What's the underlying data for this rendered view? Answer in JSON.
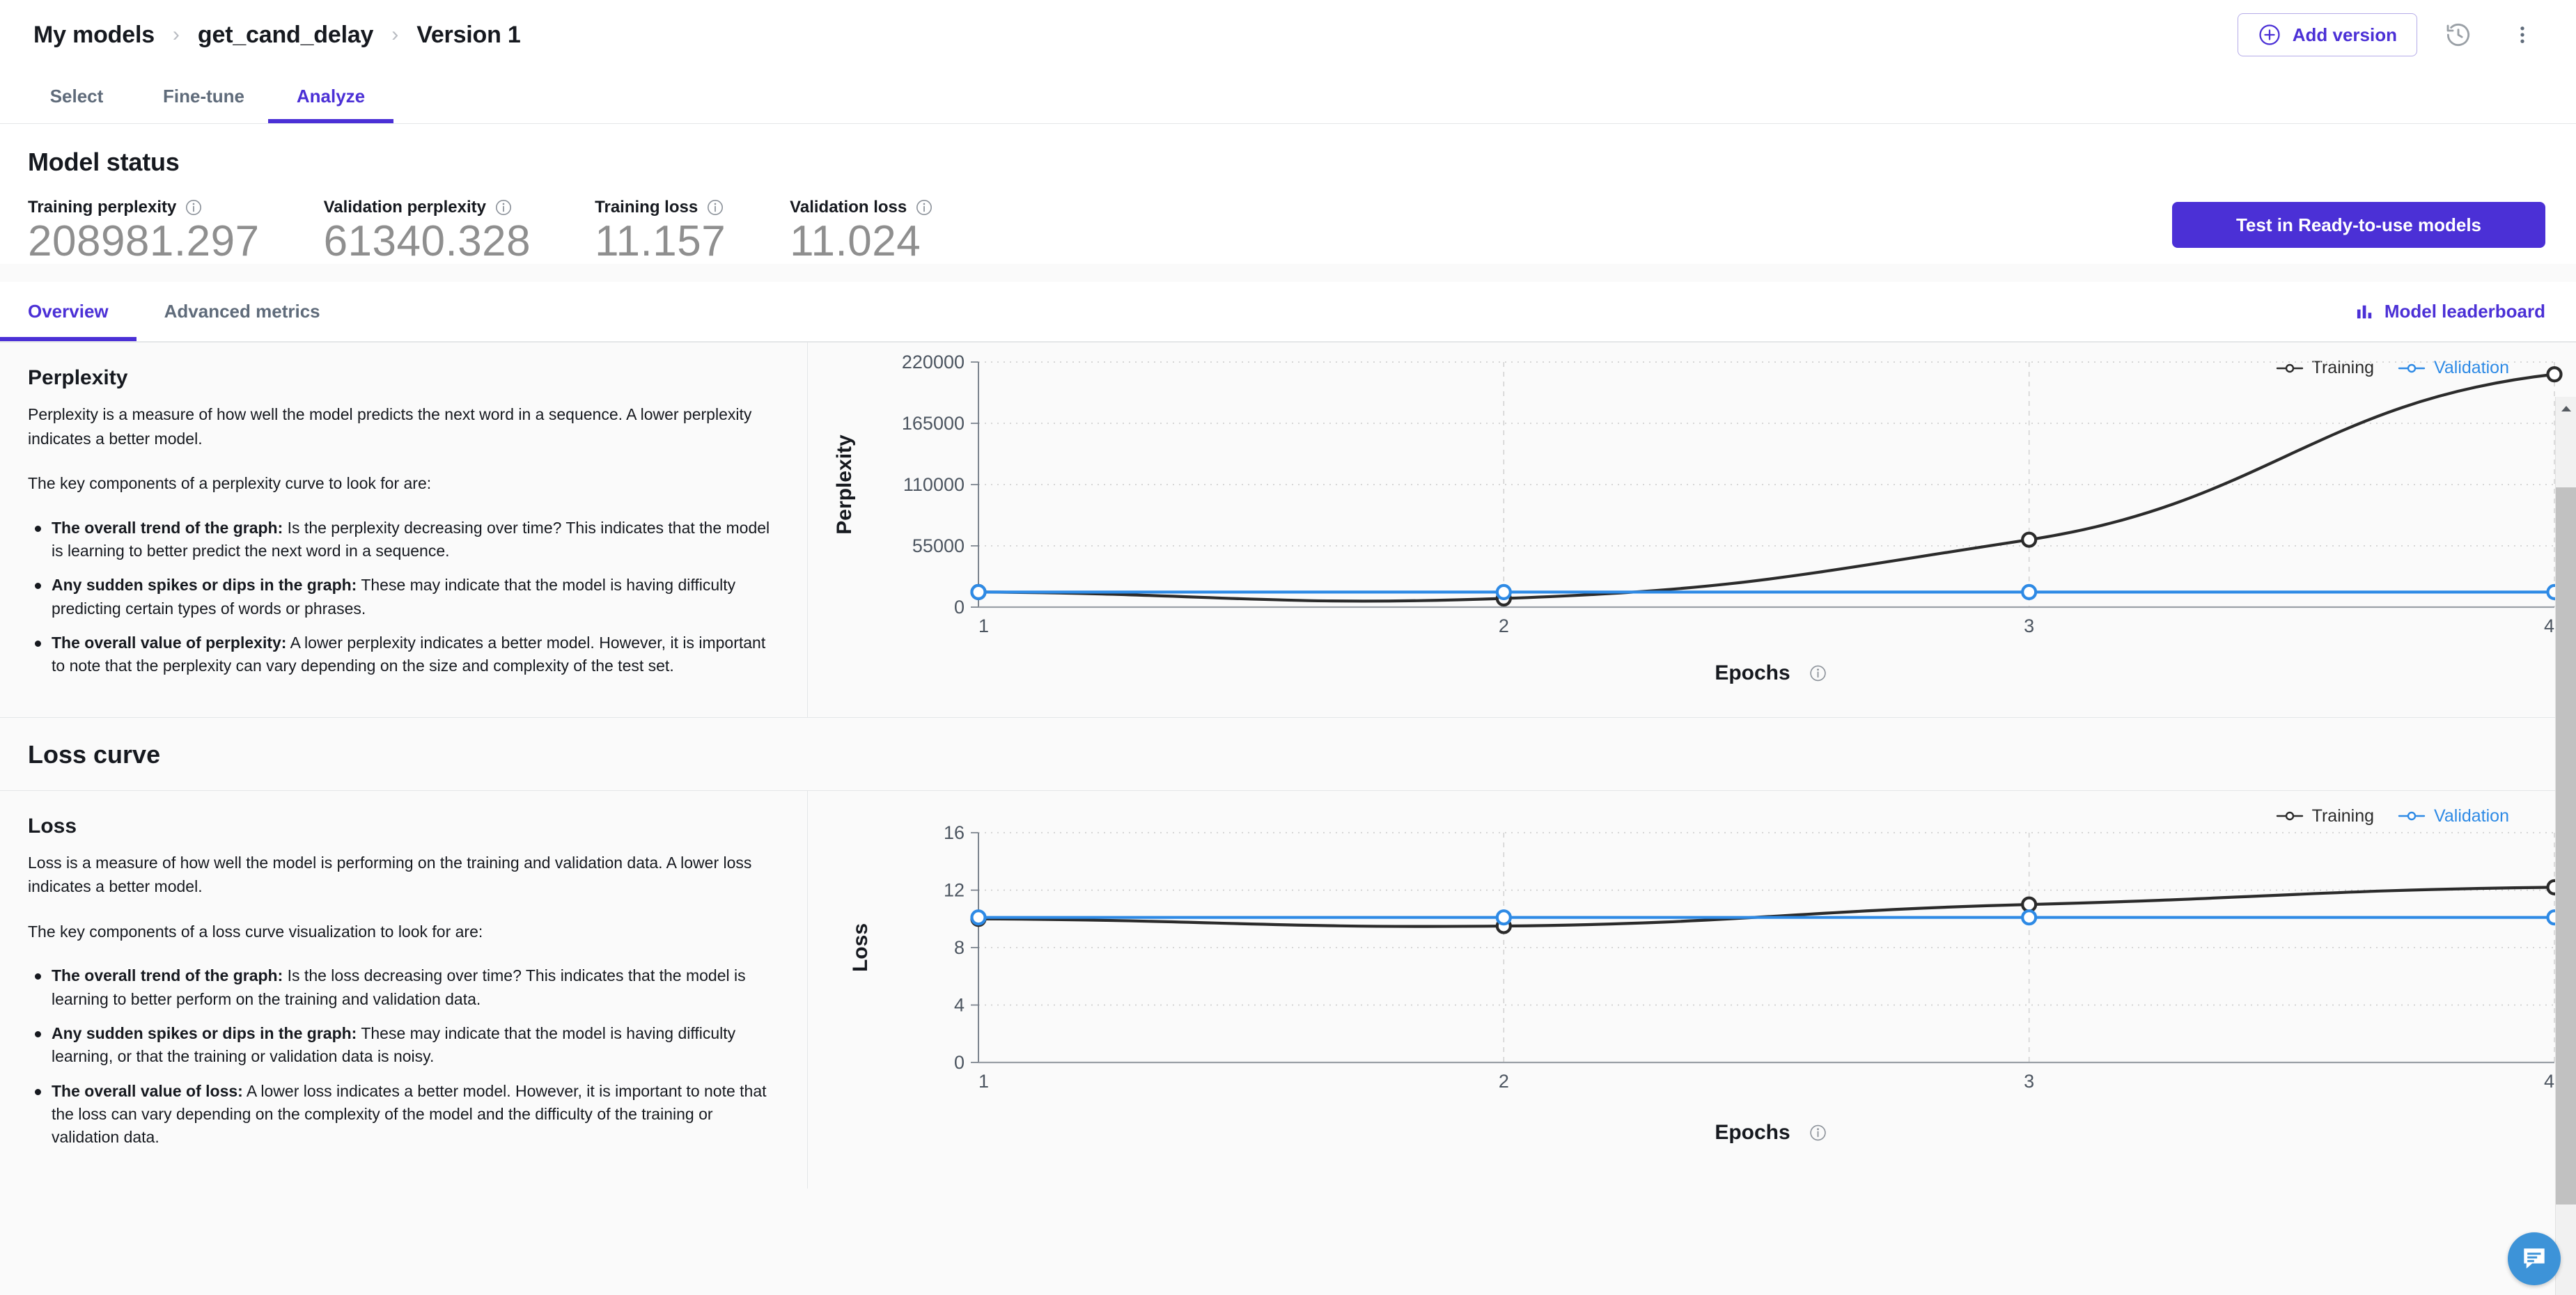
{
  "header": {
    "breadcrumb": [
      "My models",
      "get_cand_delay",
      "Version 1"
    ],
    "separator": "›",
    "add_version_label": "Add version",
    "history_icon": "history-icon",
    "more_icon": "kebab-menu-icon"
  },
  "primary_tabs": [
    {
      "label": "Select",
      "active": false
    },
    {
      "label": "Fine-tune",
      "active": false
    },
    {
      "label": "Analyze",
      "active": true
    }
  ],
  "model_status": {
    "title": "Model status",
    "metrics": [
      {
        "label": "Training perplexity",
        "value": "208981.297"
      },
      {
        "label": "Validation perplexity",
        "value": "61340.328"
      },
      {
        "label": "Training loss",
        "value": "11.157"
      },
      {
        "label": "Validation loss",
        "value": "11.024"
      }
    ],
    "test_button": "Test in Ready-to-use models"
  },
  "secondary_tabs": [
    {
      "label": "Overview",
      "active": true
    },
    {
      "label": "Advanced metrics",
      "active": false
    }
  ],
  "leaderboard": {
    "label": "Model leaderboard",
    "icon": "bar-chart-icon"
  },
  "perplexity_panel": {
    "heading": "Perplexity",
    "intro": "Perplexity is a measure of how well the model predicts the next word in a sequence. A lower perplexity indicates a better model.",
    "lead": "The key components of a perplexity curve to look for are:",
    "bullets": [
      {
        "term": "The overall trend of the graph:",
        "text": " Is the perplexity decreasing over time? This indicates that the model is learning to better predict the next word in a sequence."
      },
      {
        "term": "Any sudden spikes or dips in the graph:",
        "text": " These may indicate that the model is having difficulty predicting certain types of words or phrases."
      },
      {
        "term": "The overall value of perplexity:",
        "text": " A lower perplexity indicates a better model. However, it is important to note that the perplexity can vary depending on the size and complexity of the test set."
      }
    ]
  },
  "loss_section": {
    "title": "Loss curve",
    "heading": "Loss",
    "intro": "Loss is a measure of how well the model is performing on the training and validation data. A lower loss indicates a better model.",
    "lead": "The key components of a loss curve visualization to look for are:",
    "bullets": [
      {
        "term": "The overall trend of the graph:",
        "text": " Is the loss decreasing over time? This indicates that the model is learning to better perform on the training and validation data."
      },
      {
        "term": "Any sudden spikes or dips in the graph:",
        "text": " These may indicate that the model is having difficulty learning, or that the training or validation data is noisy."
      },
      {
        "term": "The overall value of loss:",
        "text": " A lower loss indicates a better model. However, it is important to note that the loss can vary depending on the complexity of the model and the difficulty of the training or validation data."
      }
    ]
  },
  "chat_widget": {
    "icon": "chat-bubble-icon",
    "color": "#3d93d8"
  },
  "colors": {
    "accent": "#4b30d6",
    "training": "#2b2b2b",
    "validation": "#2e8ae5",
    "text": "#16191f",
    "muted": "#5f6b7a"
  },
  "chart_data": [
    {
      "id": "perplexity",
      "type": "line",
      "title": "",
      "xlabel": "Epochs",
      "ylabel": "Perplexity",
      "x": [
        1,
        2,
        3,
        4
      ],
      "xticks": [
        "1",
        "2",
        "3",
        "4"
      ],
      "yticks": [
        "0",
        "55000",
        "110000",
        "165000",
        "220000"
      ],
      "ylim": [
        0,
        220000
      ],
      "grid": true,
      "legend_position": "top-right",
      "series": [
        {
          "name": "Training",
          "color": "#2b2b2b",
          "values": [
            13500,
            7800,
            60500,
            208981.297
          ]
        },
        {
          "name": "Validation",
          "color": "#2e8ae5",
          "values": [
            13500,
            13500,
            13500,
            13500
          ]
        }
      ]
    },
    {
      "id": "loss",
      "type": "line",
      "title": "",
      "xlabel": "Epochs",
      "ylabel": "Loss",
      "x": [
        1,
        2,
        3,
        4
      ],
      "xticks": [
        "1",
        "2",
        "3",
        "4"
      ],
      "yticks": [
        "0",
        "4",
        "8",
        "12",
        "16"
      ],
      "ylim": [
        0,
        16
      ],
      "grid": true,
      "legend_position": "top-right",
      "series": [
        {
          "name": "Training",
          "color": "#2b2b2b",
          "values": [
            10.0,
            9.5,
            11.0,
            12.2
          ]
        },
        {
          "name": "Validation",
          "color": "#2e8ae5",
          "values": [
            10.1,
            10.1,
            10.1,
            10.1
          ]
        }
      ]
    }
  ],
  "chart_legend": {
    "training": "Training",
    "validation": "Validation"
  },
  "epochs_info_icon": "info-icon"
}
